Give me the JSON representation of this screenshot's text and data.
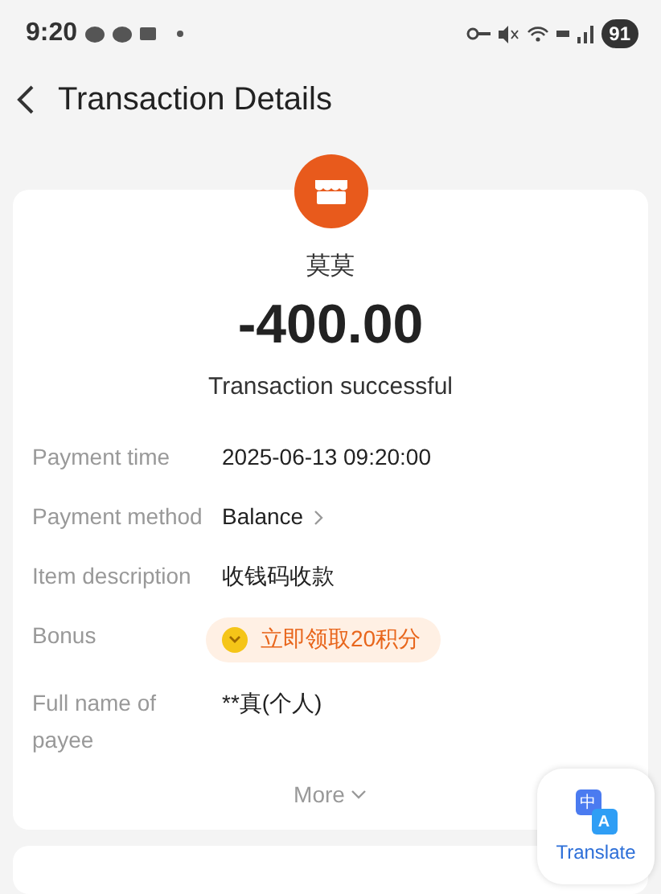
{
  "status_bar": {
    "time": "9:20",
    "battery": "91"
  },
  "header": {
    "title": "Transaction Details"
  },
  "summary": {
    "merchant": "莫莫",
    "amount": "-400.00",
    "status": "Transaction successful"
  },
  "details": [
    {
      "kind": "text",
      "label": "Payment time",
      "value": "2025-06-13 09:20:00"
    },
    {
      "kind": "link",
      "label": "Payment method",
      "value": "Balance"
    },
    {
      "kind": "text",
      "label": "Item description",
      "value": "收钱码收款"
    },
    {
      "kind": "bonus",
      "label": "Bonus",
      "value": "立即领取20积分"
    },
    {
      "kind": "text",
      "label": "Full name of payee",
      "value": "**真(个人)"
    }
  ],
  "more": {
    "label": "More",
    "expanded": false
  },
  "translate": {
    "label": "Translate",
    "glyph_source": "中",
    "glyph_target": "A"
  }
}
